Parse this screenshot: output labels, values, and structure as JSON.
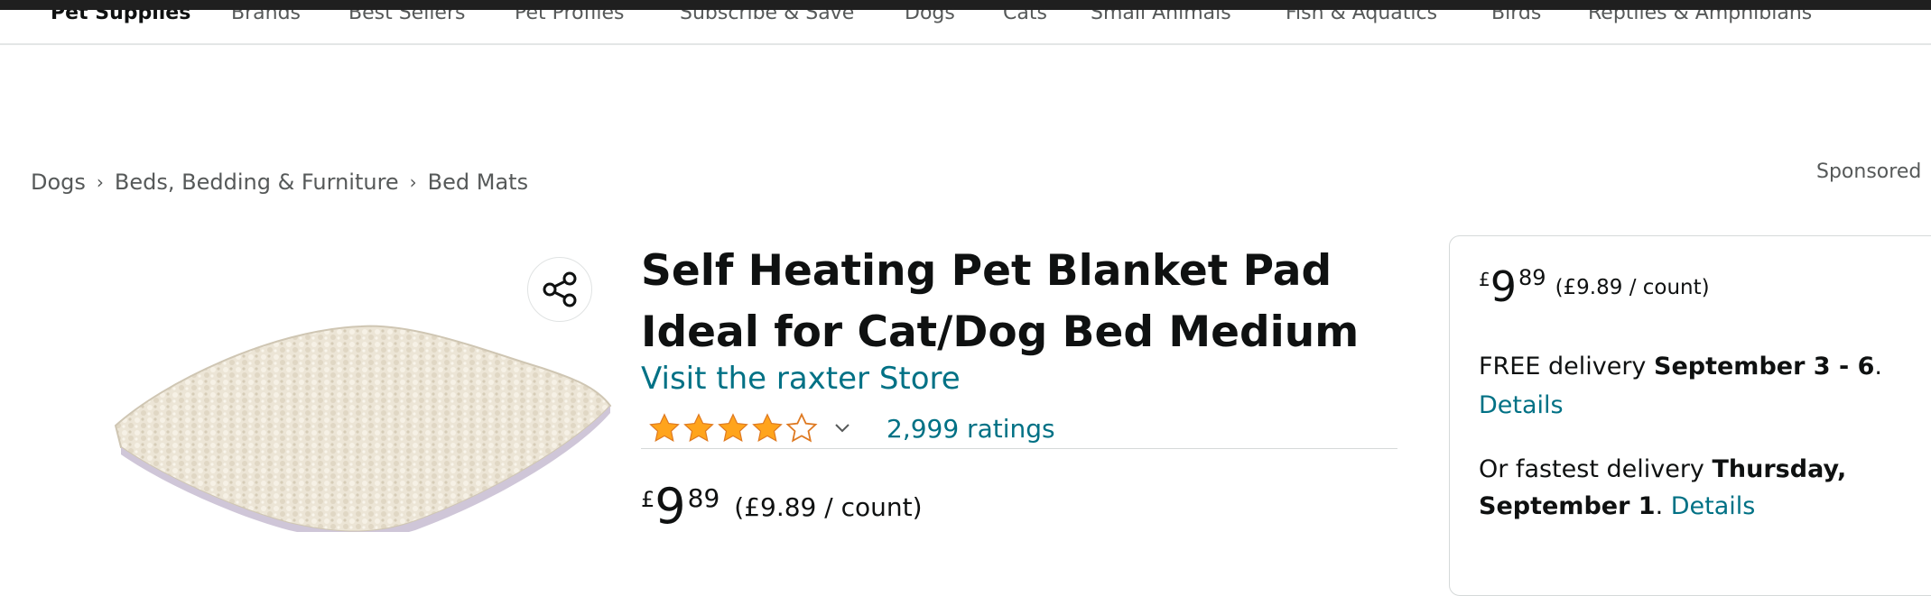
{
  "subnav": {
    "items": [
      "Pet Supplies",
      "Brands",
      "Best Sellers",
      "Pet Profiles",
      "Subscribe & Save",
      "Dogs",
      "Cats",
      "Small Animals",
      "Fish & Aquatics",
      "Birds",
      "Reptiles & Amphibians"
    ]
  },
  "breadcrumb": [
    "Dogs",
    "Beds, Bedding & Furniture",
    "Bed Mats"
  ],
  "breadcrumb_separator": "›",
  "sponsored": "Sponsored",
  "product": {
    "title": "Self Heating Pet Blanket Pad Ideal for Cat/Dog Bed Medium",
    "store_link": "Visit the raxter Store",
    "rating_value": 4.0,
    "ratings_text": "2,999 ratings",
    "price_currency": "£",
    "price_whole": "9",
    "price_fraction": "89",
    "price_per_unit": "(£9.89 / count)"
  },
  "buybox": {
    "price_currency": "£",
    "price_whole": "9",
    "price_fraction": "89",
    "price_per_unit": "(£9.89 / count)",
    "delivery_prefix": "FREE delivery ",
    "delivery_date": "September 3 - 6",
    "delivery_suffix": ".",
    "details_label": "Details",
    "fastest_prefix": "Or fastest delivery ",
    "fastest_date_line1": "Thursday,",
    "fastest_date_line2": "September 1",
    "fastest_suffix": ". ",
    "fastest_details_label": "Details"
  },
  "colors": {
    "link": "#007185",
    "star": "#ffa41c",
    "text": "#0f1111",
    "muted": "#565959"
  },
  "icons": [
    "share-icon",
    "star-icon",
    "chevron-down-icon"
  ]
}
